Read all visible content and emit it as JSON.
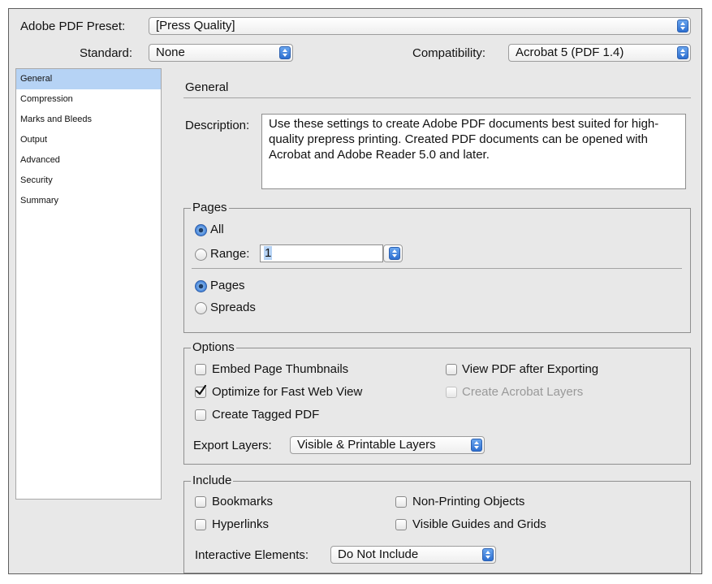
{
  "header": {
    "preset_label": "Adobe PDF Preset:",
    "preset_value": "[Press Quality]",
    "standard_label": "Standard:",
    "standard_value": "None",
    "compat_label": "Compatibility:",
    "compat_value": "Acrobat 5 (PDF 1.4)"
  },
  "sidebar": {
    "items": [
      {
        "label": "General",
        "selected": true
      },
      {
        "label": "Compression"
      },
      {
        "label": "Marks and Bleeds"
      },
      {
        "label": "Output"
      },
      {
        "label": "Advanced"
      },
      {
        "label": "Security"
      },
      {
        "label": "Summary"
      }
    ]
  },
  "general": {
    "title": "General",
    "description_label": "Description:",
    "description_text": "Use these settings to create Adobe PDF documents best suited for high-quality prepress printing.  Created PDF documents can be opened with Acrobat and Adobe Reader 5.0 and later."
  },
  "pages": {
    "title": "Pages",
    "all_label": "All",
    "all_selected": true,
    "range_label": "Range:",
    "range_value": "1",
    "pages_label": "Pages",
    "pages_selected": true,
    "spreads_label": "Spreads"
  },
  "options": {
    "title": "Options",
    "embed_thumbnails": {
      "label": "Embed Page Thumbnails",
      "checked": false
    },
    "view_pdf": {
      "label": "View PDF after Exporting",
      "checked": false
    },
    "optimize_web": {
      "label": "Optimize for Fast Web View",
      "checked": true
    },
    "acrobat_layers": {
      "label": "Create Acrobat Layers",
      "checked": false,
      "disabled": true
    },
    "tagged_pdf": {
      "label": "Create Tagged PDF",
      "checked": false
    },
    "export_layers_label": "Export Layers:",
    "export_layers_value": "Visible & Printable Layers"
  },
  "include": {
    "title": "Include",
    "bookmarks": {
      "label": "Bookmarks",
      "checked": false
    },
    "non_printing": {
      "label": "Non-Printing Objects",
      "checked": false
    },
    "hyperlinks": {
      "label": "Hyperlinks",
      "checked": false
    },
    "guides_grids": {
      "label": "Visible Guides and Grids",
      "checked": false
    },
    "interactive_label": "Interactive Elements:",
    "interactive_value": "Do Not Include"
  },
  "icons": {
    "popup": "updown-arrows-icon",
    "checkmark": "checkmark-icon"
  },
  "colors": {
    "selection": "#b6d3f5",
    "accent": "#3a7bd6",
    "panel": "#e8e8e8"
  }
}
